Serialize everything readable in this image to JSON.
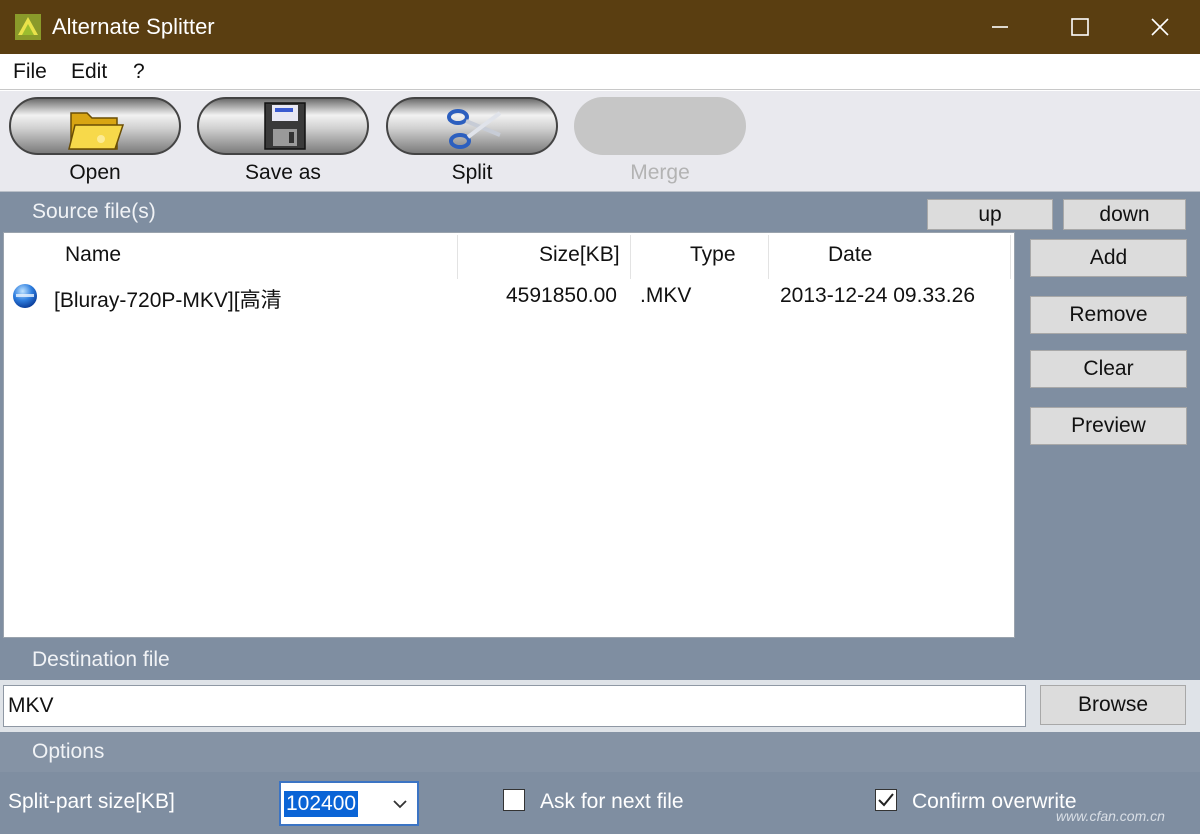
{
  "window": {
    "title": "Alternate Splitter",
    "controls": {
      "minimize": "—",
      "maximize": "☐",
      "close": "✕"
    }
  },
  "menu": {
    "items": [
      "File",
      "Edit",
      "?"
    ]
  },
  "toolbar": {
    "buttons": [
      {
        "label": "Open",
        "icon": "folder-icon",
        "enabled": true
      },
      {
        "label": "Save as",
        "icon": "floppy-disk-icon",
        "enabled": true
      },
      {
        "label": "Split",
        "icon": "scissors-icon",
        "enabled": true
      },
      {
        "label": "Merge",
        "icon": "",
        "enabled": false
      }
    ]
  },
  "source": {
    "section_title": "Source file(s)",
    "up_label": "up",
    "down_label": "down",
    "columns": {
      "name": "Name",
      "size": "Size[KB]",
      "type": "Type",
      "date": "Date"
    },
    "files": [
      {
        "name": "[Bluray-720P-MKV][高清",
        "size": "4591850.00",
        "type": ".MKV",
        "date": "2013-12-24 09.33.26",
        "icon": "blue-file-icon"
      }
    ],
    "side_buttons": {
      "add": "Add",
      "remove": "Remove",
      "clear": "Clear",
      "preview": "Preview"
    }
  },
  "destination": {
    "section_title": "Destination file",
    "value": "MKV",
    "browse_label": "Browse"
  },
  "options": {
    "section_title": "Options",
    "split_size_label": "Split-part size[KB]",
    "split_size_value": "102400",
    "ask_next_label": "Ask for next file",
    "ask_next_checked": false,
    "confirm_overwrite_label": "Confirm overwrite",
    "confirm_overwrite_checked": true
  },
  "watermark": "www.cfan.com.cn",
  "colors": {
    "titlebar": "#5a3e11",
    "panel": "#7f8ea1",
    "selection": "#0a64d6"
  }
}
